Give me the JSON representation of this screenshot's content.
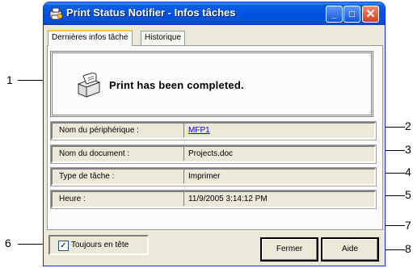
{
  "window": {
    "title": "Print Status Notifier - Infos tâches",
    "minimize": "_",
    "maximize": "□",
    "close": "✕"
  },
  "tabs": [
    {
      "label": "Dernières infos tâche",
      "active": true
    },
    {
      "label": "Historique",
      "active": false
    }
  ],
  "message": "Print has been completed.",
  "fields": [
    {
      "label": "Nom du périphérique :",
      "value": "MFP1",
      "link": true
    },
    {
      "label": "Nom du document :",
      "value": "Projects.doc"
    },
    {
      "label": "Type de tâche :",
      "value": "Imprimer"
    },
    {
      "label": "Heure :",
      "value": "11/9/2005 3:14:12 PM"
    }
  ],
  "checkbox": {
    "label": "Toujours en tête",
    "checked": true,
    "mark": "✓"
  },
  "buttons": {
    "close": "Fermer",
    "help": "Aide"
  },
  "callouts": [
    "1",
    "2",
    "3",
    "4",
    "5",
    "6",
    "7",
    "8"
  ],
  "icons": [
    "printer-notifier-icon",
    "printer-complete-icon"
  ],
  "colors": {
    "titlebar": "#0053e3",
    "link": "#0000ff",
    "face": "#ece9d8"
  }
}
